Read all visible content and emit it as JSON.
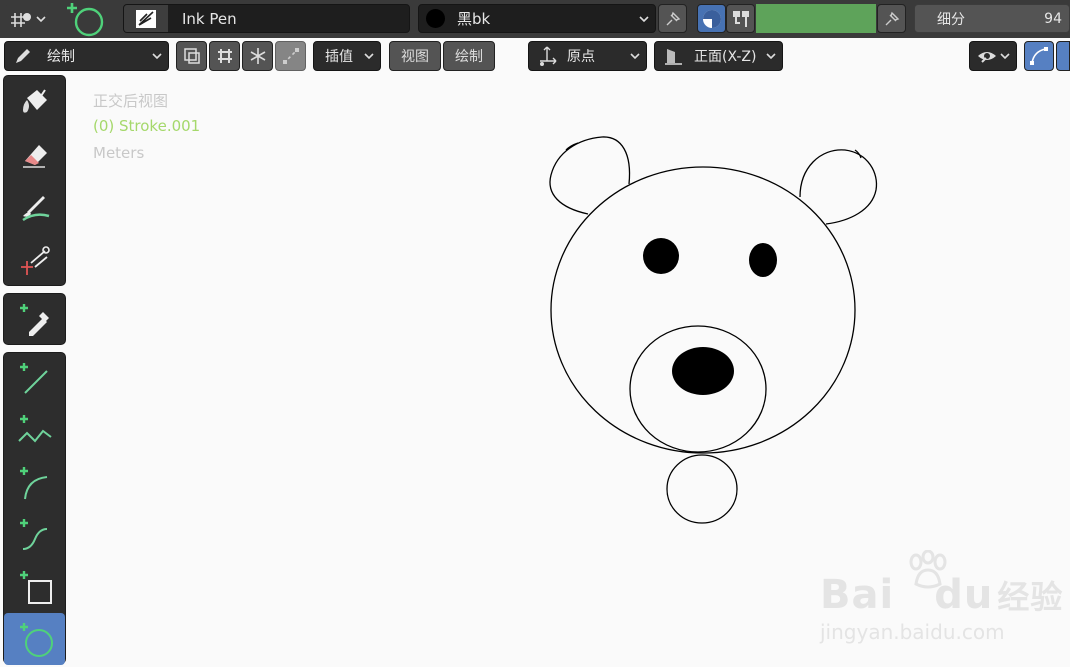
{
  "top_bar": {
    "brush_name": "Ink Pen",
    "material_name": "黑bk",
    "subdivision_label": "细分",
    "subdivision_value": "94"
  },
  "header": {
    "mode_label": "绘制",
    "interpolate_label": "插值",
    "view_label": "视图",
    "draw_label": "绘制",
    "origin_label": "原点",
    "plane_label": "正面(X-Z)"
  },
  "viewport": {
    "view_name": "正交后视图",
    "object_info": "(0) Stroke.001",
    "units": "Meters"
  },
  "watermark": {
    "brand": "Bai",
    "brand_tail": "du",
    "suffix": "经验",
    "url": "jingyan.baidu.com"
  },
  "colors": {
    "accent": "#5680c2",
    "info_green": "#a5d86b",
    "bar_green": "#5ea35a"
  },
  "icons": [
    "cursor-icon",
    "circle-tool-icon",
    "brush-icon",
    "pin-icon",
    "overlay-icon",
    "fill-icon",
    "erase-icon",
    "tint-icon",
    "cutter-icon",
    "eyedropper-icon",
    "line-icon",
    "polyline-icon",
    "arc-icon",
    "curve-icon",
    "box-icon",
    "eye-icon",
    "guides-icon"
  ]
}
